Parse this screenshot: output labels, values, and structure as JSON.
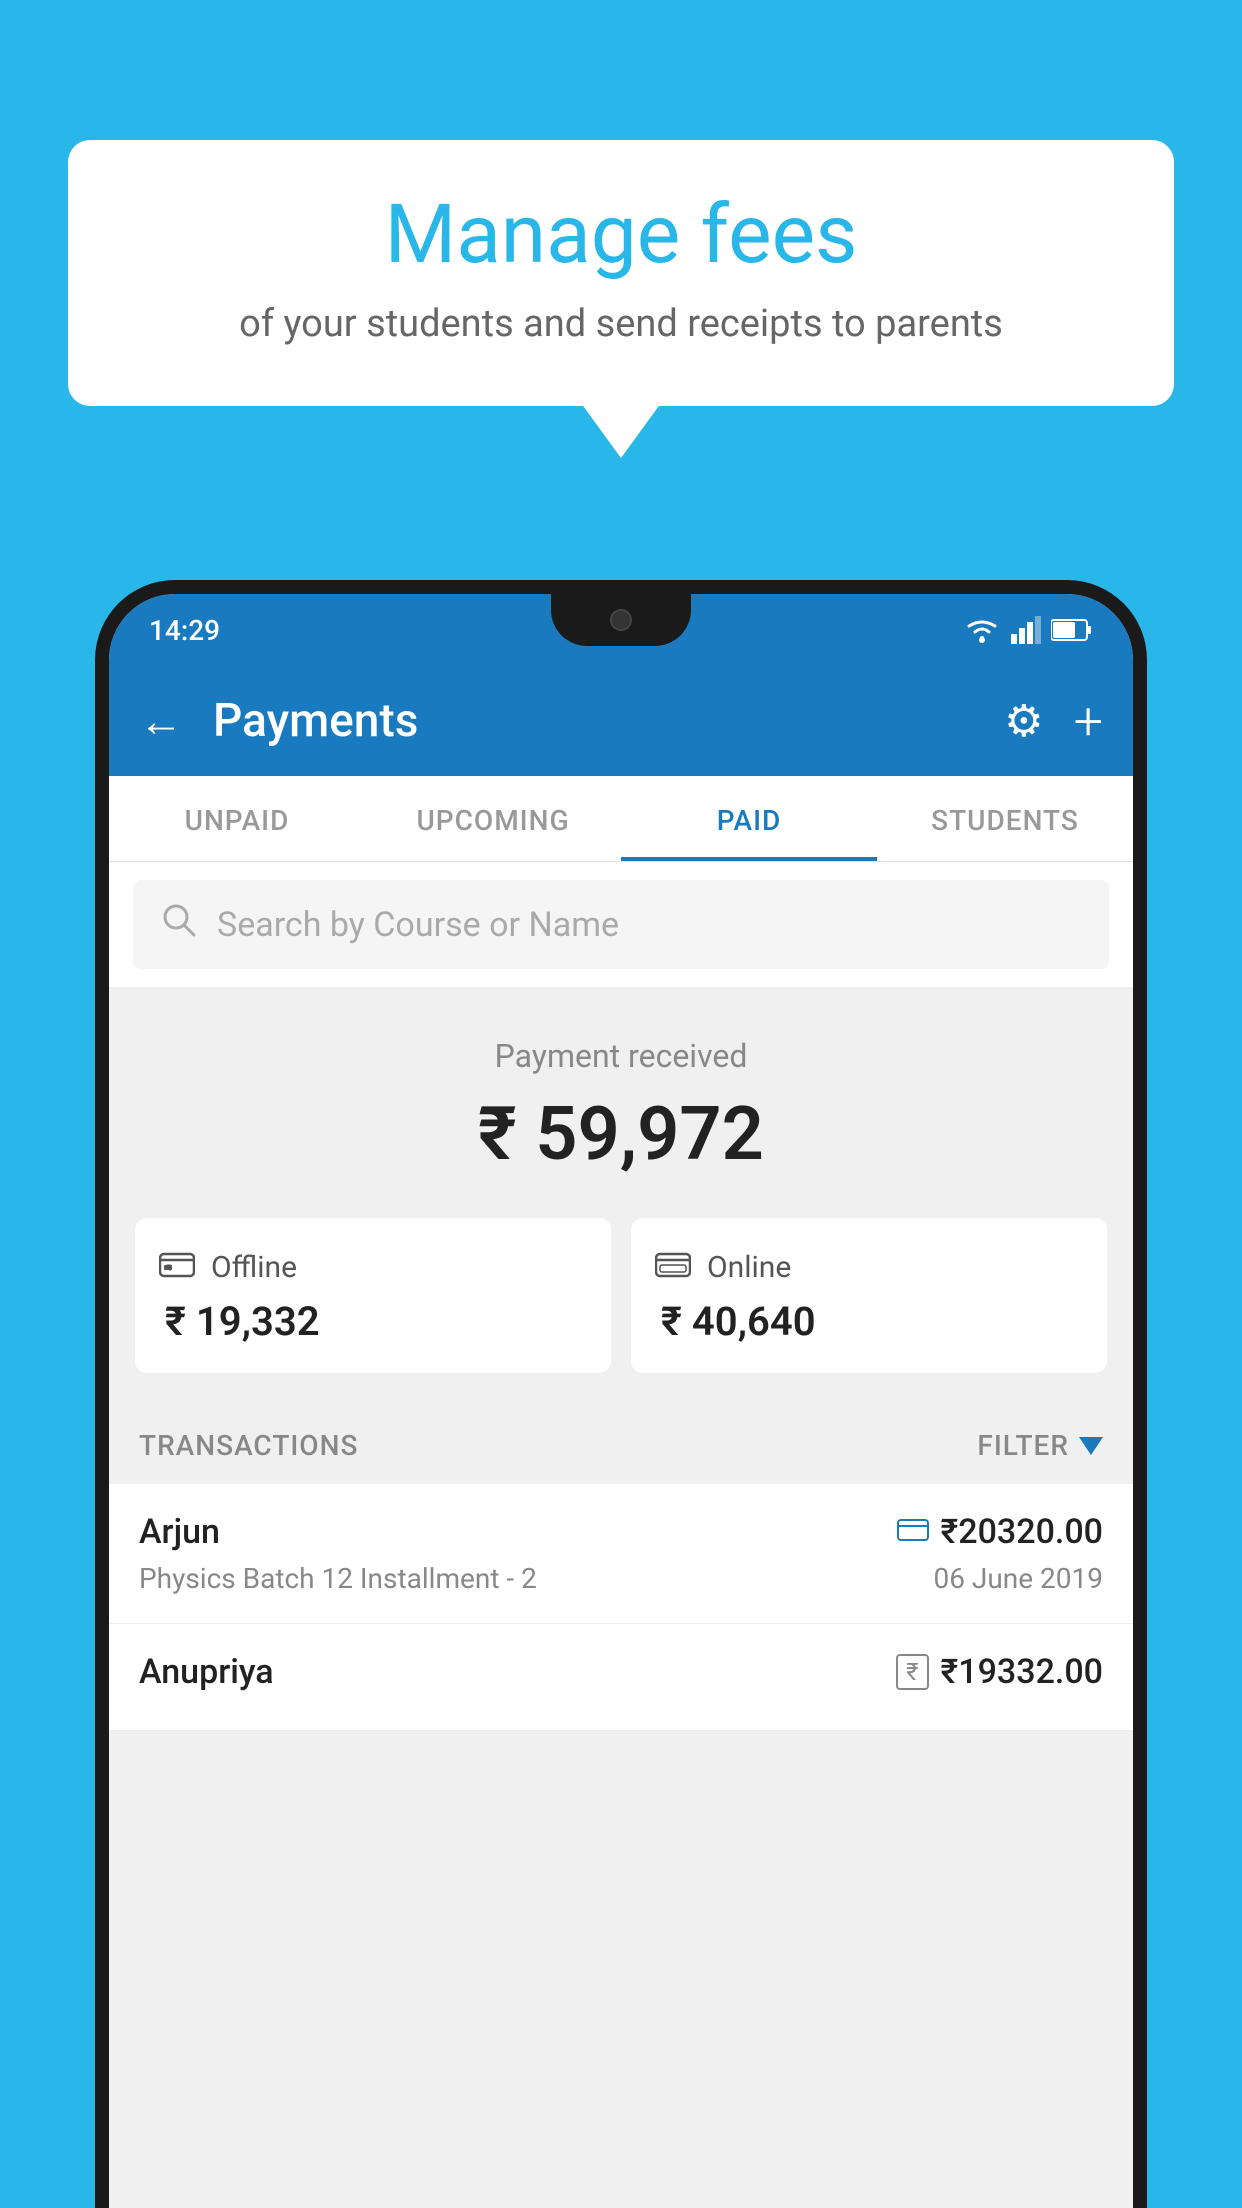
{
  "background_color": "#29b6e8",
  "bubble": {
    "title": "Manage fees",
    "subtitle": "of your students and send receipts to parents"
  },
  "status_bar": {
    "time": "14:29"
  },
  "app_bar": {
    "title": "Payments",
    "back_label": "←",
    "gear_label": "⚙",
    "plus_label": "+"
  },
  "tabs": [
    {
      "id": "unpaid",
      "label": "UNPAID",
      "active": false
    },
    {
      "id": "upcoming",
      "label": "UPCOMING",
      "active": false
    },
    {
      "id": "paid",
      "label": "PAID",
      "active": true
    },
    {
      "id": "students",
      "label": "STUDENTS",
      "active": false
    }
  ],
  "search": {
    "placeholder": "Search by Course or Name"
  },
  "payment_summary": {
    "label": "Payment received",
    "amount": "₹ 59,972",
    "offline_label": "Offline",
    "offline_amount": "₹ 19,332",
    "online_label": "Online",
    "online_amount": "₹ 40,640"
  },
  "transactions": {
    "header": "TRANSACTIONS",
    "filter_label": "FILTER",
    "items": [
      {
        "name": "Arjun",
        "amount": "₹20320.00",
        "payment_mode": "card",
        "course": "Physics Batch 12 Installment - 2",
        "date": "06 June 2019"
      },
      {
        "name": "Anupriya",
        "amount": "₹19332.00",
        "payment_mode": "cash",
        "course": "",
        "date": ""
      }
    ]
  }
}
